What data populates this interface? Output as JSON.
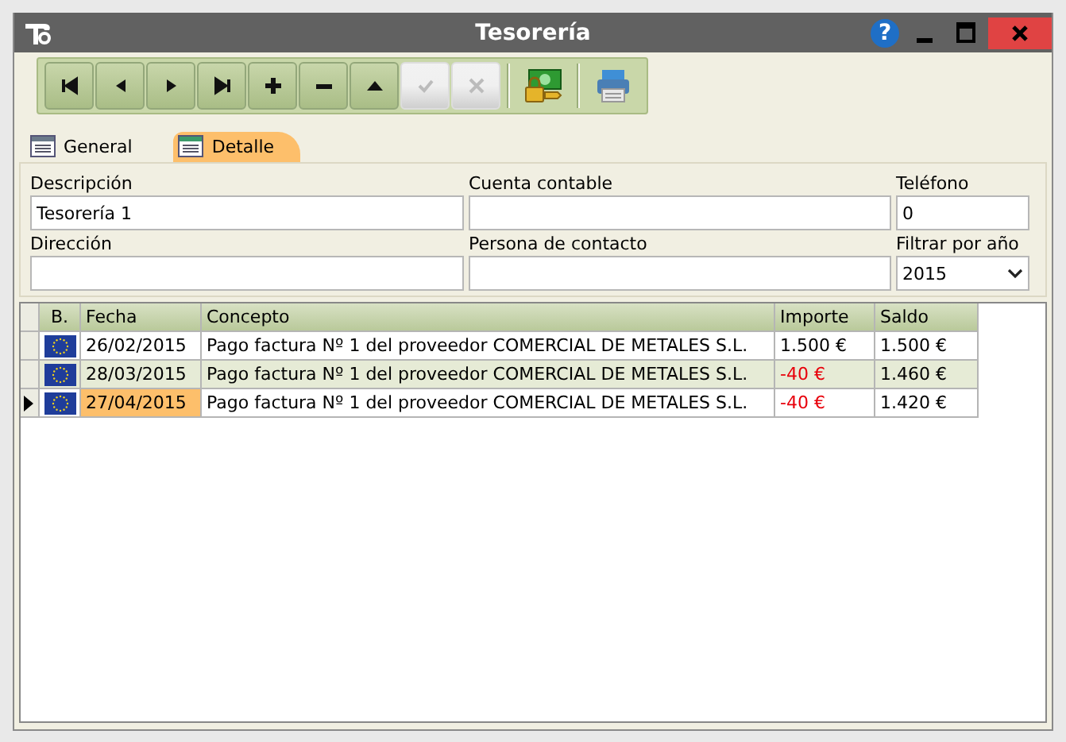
{
  "window": {
    "title": "Tesorería",
    "help_label": "?"
  },
  "toolbar": [
    {
      "kind": "first",
      "disabled": false
    },
    {
      "kind": "prev",
      "disabled": false
    },
    {
      "kind": "next",
      "disabled": false
    },
    {
      "kind": "last",
      "disabled": false
    },
    {
      "kind": "add",
      "disabled": false
    },
    {
      "kind": "remove",
      "disabled": false
    },
    {
      "kind": "up",
      "disabled": false
    },
    {
      "kind": "confirm",
      "disabled": true
    },
    {
      "kind": "cancel",
      "disabled": true
    }
  ],
  "tabs": [
    {
      "label": "General",
      "selected": false
    },
    {
      "label": "Detalle",
      "selected": true
    }
  ],
  "fields": [
    {
      "label": "Descripción",
      "value": "Tesorería 1",
      "kind": "text"
    },
    {
      "label": "Cuenta contable",
      "kind": "text"
    },
    {
      "label": "Teléfono",
      "value": "0",
      "kind": "text"
    },
    {
      "label": "Dirección",
      "kind": "text"
    },
    {
      "label": "Persona de contacto",
      "kind": "text"
    },
    {
      "label": "Filtrar por año",
      "value": "2015",
      "kind": "select"
    }
  ],
  "table": {
    "columns": [
      "B.",
      "Fecha",
      "Concepto",
      "Importe",
      "Saldo"
    ],
    "rows": [
      {
        "fecha": "26/02/2015",
        "concepto": "Pago factura Nº 1 del proveedor COMERCIAL DE METALES S.L.",
        "importe": "1.500 €",
        "negative": false,
        "saldo": "1.500 €",
        "current": false
      },
      {
        "fecha": "28/03/2015",
        "concepto": "Pago factura Nº 1 del proveedor COMERCIAL DE METALES S.L.",
        "importe": "-40 €",
        "negative": true,
        "saldo": "1.460 €",
        "current": false
      },
      {
        "fecha": "27/04/2015",
        "concepto": "Pago factura Nº 1 del proveedor COMERCIAL DE METALES S.L.",
        "importe": "-40 €",
        "negative": true,
        "saldo": "1.420 €",
        "current": true
      }
    ]
  }
}
